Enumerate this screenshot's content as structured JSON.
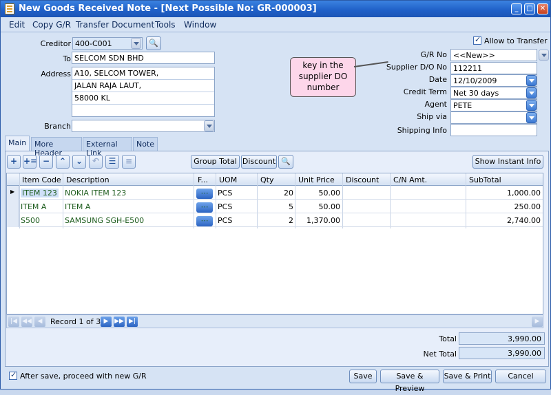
{
  "window": {
    "title": "New Goods Received Note - [Next Possible No: GR-000003]"
  },
  "menu": [
    "Edit",
    "Copy G/R",
    "Transfer Document",
    "Tools",
    "Window"
  ],
  "form": {
    "creditor_label": "Creditor",
    "creditor": "400-C001",
    "to_label": "To",
    "to": "SELCOM SDN BHD",
    "address_label": "Address",
    "address": [
      "A10, SELCOM TOWER,",
      "JALAN RAJA LAUT,",
      "58000 KL",
      ""
    ],
    "branch_label": "Branch",
    "branch": "",
    "allow_transfer_label": "Allow to Transfer",
    "gr_no_label": "G/R  No",
    "gr_no": "<<New>>",
    "supplier_do_label": "Supplier D/O No",
    "supplier_do": "112211",
    "date_label": "Date",
    "date": "12/10/2009",
    "credit_term_label": "Credit Term",
    "credit_term": "Net 30 days",
    "agent_label": "Agent",
    "agent": "PETE",
    "ship_via_label": "Ship via",
    "ship_via": "",
    "shipping_info_label": "Shipping Info",
    "shipping_info": ""
  },
  "callout": {
    "text": "key in the supplier DO number"
  },
  "tabs": [
    "Main",
    "More Header",
    "External Link",
    "Note"
  ],
  "toolbar": {
    "group_total": "Group Total",
    "discount": "Discount",
    "instant_info": "Show Instant Info"
  },
  "grid": {
    "columns": [
      "Item Code",
      "Description",
      "F...",
      "UOM",
      "Qty",
      "Unit Price",
      "Discount",
      "C/N Amt.",
      "SubTotal"
    ],
    "rows": [
      {
        "code": "ITEM 123",
        "desc": "NOKIA ITEM 123",
        "uom": "PCS",
        "qty": "20",
        "price": "50.00",
        "discount": "",
        "cn": "",
        "subtotal": "1,000.00"
      },
      {
        "code": "ITEM A",
        "desc": "ITEM A",
        "uom": "PCS",
        "qty": "5",
        "price": "50.00",
        "discount": "",
        "cn": "",
        "subtotal": "250.00"
      },
      {
        "code": "S500",
        "desc": "SAMSUNG SGH-E500",
        "uom": "PCS",
        "qty": "2",
        "price": "1,370.00",
        "discount": "",
        "cn": "",
        "subtotal": "2,740.00"
      }
    ],
    "record_text": "Record 1 of 3"
  },
  "totals": {
    "total_label": "Total",
    "total": "3,990.00",
    "net_total_label": "Net Total",
    "net_total": "3,990.00"
  },
  "footer": {
    "proceed_label": "After save, proceed with new G/R",
    "save": "Save",
    "save_preview": "Save & Preview",
    "save_print": "Save & Print",
    "cancel": "Cancel"
  }
}
